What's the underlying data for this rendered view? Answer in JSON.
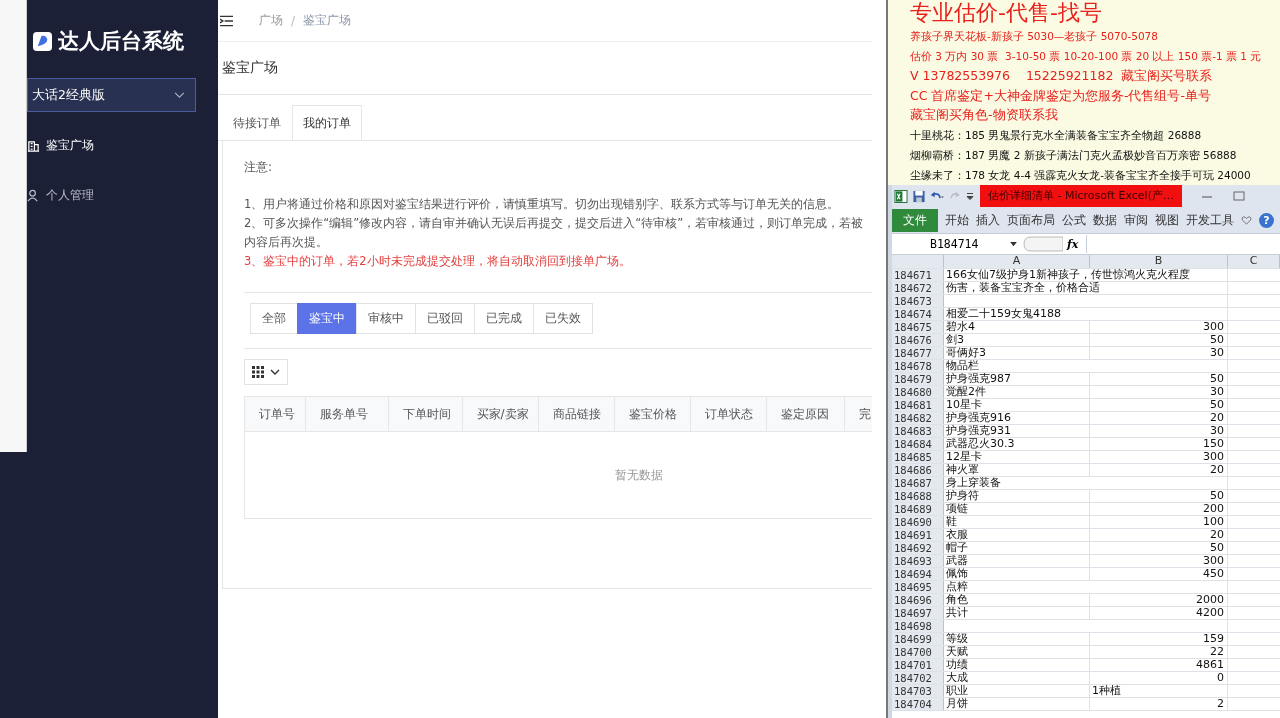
{
  "sidebar": {
    "title": "达人后台系统",
    "game_select": {
      "value": "大话2经典版"
    },
    "menu": [
      {
        "label": "鉴宝广场",
        "selected": true
      },
      {
        "label": "个人管理",
        "selected": false
      }
    ]
  },
  "breadcrumb": {
    "items": [
      "广场",
      "鉴宝广场"
    ],
    "separator": "/"
  },
  "page_title": "鉴宝广场",
  "tabs": [
    {
      "label": "待接订单",
      "selected": false
    },
    {
      "label": "我的订单",
      "selected": true
    }
  ],
  "notice": {
    "heading": "注意:",
    "lines": [
      {
        "text": "1、用户将通过价格和原因对鉴宝结果进行评价，请慎重填写。切勿出现错别字、联系方式等与订单无关的信息。",
        "warning": false
      },
      {
        "text": "2、可多次操作“编辑”修改内容，请自审并确认无误后再提交，提交后进入“待审核”，若审核通过，则订单完成，若被",
        "warning": false
      },
      {
        "text": "内容后再次提。",
        "warning": false
      },
      {
        "text": "3、鉴宝中的订单，若2小时未完成提交处理，将自动取消回到接单广场。",
        "warning": true
      }
    ]
  },
  "status_filters": [
    {
      "label": "全部",
      "selected": false
    },
    {
      "label": "鉴宝中",
      "selected": true
    },
    {
      "label": "审核中",
      "selected": false
    },
    {
      "label": "已驳回",
      "selected": false
    },
    {
      "label": "已完成",
      "selected": false
    },
    {
      "label": "已失效",
      "selected": false
    }
  ],
  "table": {
    "columns": [
      "订单号",
      "服务单号",
      "下单时间",
      "买家/卖家",
      "商品链接",
      "鉴宝价格",
      "订单状态",
      "鉴定原因",
      "完"
    ],
    "empty_text": "暂无数据"
  },
  "document": {
    "lines": [
      {
        "text": "专业估价-代售-找号",
        "kind": "title",
        "color": "#e8211c"
      },
      {
        "text": "养孩子界天花板-新孩子 5030—老孩子 5070-5078",
        "kind": "small",
        "color": "#e8211c"
      },
      {
        "text": "估价 3 万内 30 票  3-10-50 票 10-20-100 票 20 以上 150 票-1 票 1 元",
        "kind": "small",
        "color": "#e8211c"
      },
      {
        "text": "V 13782553976    15225921182  藏宝阁买号联系",
        "kind": "medium",
        "color": "#e8211c"
      },
      {
        "text": "CC 首席鉴定+大神金牌鉴定为您服务-代售组号-单号",
        "kind": "medium",
        "color": "#e8211c"
      },
      {
        "text": "藏宝阁买角色-物资联系我",
        "kind": "medium",
        "color": "#e8211c"
      },
      {
        "text": "十里桃花：185 男鬼景行克水全满装备宝宝齐全物超 26888",
        "kind": "small",
        "color": "#111111"
      },
      {
        "text": "烟柳霸桥：187 男魔 2 新孩子满法门克火孟极妙音百万亲密 56888",
        "kind": "small",
        "color": "#111111"
      },
      {
        "text": "尘缘未了：178 女龙 4-4 强霹克火女龙-装备宝宝齐全接手可玩 24000",
        "kind": "small",
        "color": "#111111"
      }
    ]
  },
  "excel": {
    "title": "估价详细清单  -  Microsoft Excel(产…",
    "ribbon_tabs": [
      {
        "label": "文件",
        "selected": true
      },
      {
        "label": "开始",
        "selected": false
      },
      {
        "label": "插入",
        "selected": false
      },
      {
        "label": "页面布局",
        "selected": false
      },
      {
        "label": "公式",
        "selected": false
      },
      {
        "label": "数据",
        "selected": false
      },
      {
        "label": "审阅",
        "selected": false
      },
      {
        "label": "视图",
        "selected": false
      },
      {
        "label": "开发工具",
        "selected": false
      }
    ],
    "help": "?",
    "name_box": "B184714",
    "fx": "fx",
    "columns": [
      "A",
      "B",
      "C"
    ],
    "rows": [
      {
        "n": "184671",
        "a": "166女仙7级护身1新神孩子，传世惊鸿火克火程度"
      },
      {
        "n": "184672",
        "a": "伤害，装备宝宝齐全，价格合适"
      },
      {
        "n": "184673"
      },
      {
        "n": "184674",
        "a": "相爱二十159女鬼4188"
      },
      {
        "n": "184675",
        "a": "碧水4",
        "b": "300"
      },
      {
        "n": "184676",
        "a": "剑3",
        "b": "50"
      },
      {
        "n": "184677",
        "a": "哥俩好3",
        "b": "30"
      },
      {
        "n": "184678",
        "a": "物品栏"
      },
      {
        "n": "184679",
        "a": "护身强克987",
        "b": "50"
      },
      {
        "n": "184680",
        "a": "觉醒2件",
        "b": "30"
      },
      {
        "n": "184681",
        "a": "10星卡",
        "b": "50"
      },
      {
        "n": "184682",
        "a": "护身强克916",
        "b": "20"
      },
      {
        "n": "184683",
        "a": "护身强克931",
        "b": "30"
      },
      {
        "n": "184684",
        "a": "武器忍火30.3",
        "b": "150"
      },
      {
        "n": "184685",
        "a": "12星卡",
        "b": "300"
      },
      {
        "n": "184686",
        "a": "神火罩",
        "b": "20"
      },
      {
        "n": "184687",
        "a": "身上穿装备"
      },
      {
        "n": "184688",
        "a": "护身符",
        "b": "50"
      },
      {
        "n": "184689",
        "a": "项链",
        "b": "200"
      },
      {
        "n": "184690",
        "a": "鞋",
        "b": "100"
      },
      {
        "n": "184691",
        "a": "衣服",
        "b": "20"
      },
      {
        "n": "184692",
        "a": "帽子",
        "b": "50"
      },
      {
        "n": "184693",
        "a": "武器",
        "b": "300"
      },
      {
        "n": "184694",
        "a": "佩饰",
        "b": "450"
      },
      {
        "n": "184695",
        "a": "点粹"
      },
      {
        "n": "184696",
        "a": "角色",
        "b": "2000"
      },
      {
        "n": "184697",
        "a": "共计",
        "b": "4200"
      },
      {
        "n": "184698"
      },
      {
        "n": "184699",
        "a": "等级",
        "b": "159"
      },
      {
        "n": "184700",
        "a": "天赋",
        "b": "22"
      },
      {
        "n": "184701",
        "a": "功绩",
        "b": "4861"
      },
      {
        "n": "184702",
        "a": "大成",
        "b": "0"
      },
      {
        "n": "184703",
        "a": "职业",
        "b_text": "1种植"
      },
      {
        "n": "184704",
        "a": "月饼",
        "b": "2"
      }
    ]
  }
}
